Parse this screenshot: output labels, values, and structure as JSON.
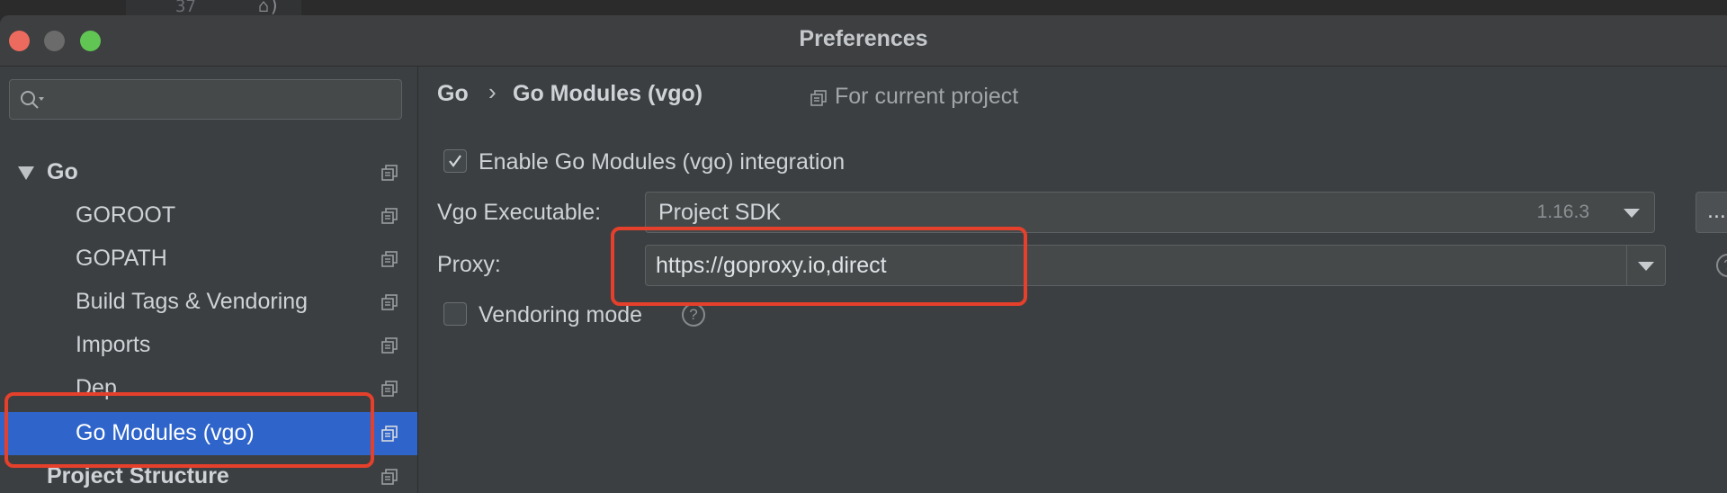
{
  "editor": {
    "line_number": "37",
    "glyph": "⌂)"
  },
  "window": {
    "title": "Preferences"
  },
  "sidebar": {
    "search": {
      "value": "",
      "placeholder": ""
    },
    "items": [
      {
        "label": "Go"
      },
      {
        "label": "GOROOT"
      },
      {
        "label": "GOPATH"
      },
      {
        "label": "Build Tags & Vendoring"
      },
      {
        "label": "Imports"
      },
      {
        "label": "Dep"
      },
      {
        "label": "Go Modules (vgo)"
      },
      {
        "label": "Project Structure"
      }
    ],
    "selected": "Go Modules (vgo)"
  },
  "main": {
    "breadcrumb": {
      "parent": "Go",
      "separator": "›",
      "current": "Go Modules (vgo)"
    },
    "scope": "For current project",
    "enable_modules": {
      "label": "Enable Go Modules (vgo) integration",
      "checked": true
    },
    "vgo_executable": {
      "label": "Vgo Executable:",
      "value": "Project SDK",
      "version": "1.16.3",
      "browse_label": "..."
    },
    "proxy": {
      "label": "Proxy:",
      "value": "https://goproxy.io,direct"
    },
    "vendoring": {
      "label": "Vendoring mode",
      "checked": false,
      "help": "?"
    }
  },
  "colors": {
    "selection": "#2f65ca",
    "annotation": "#e5402b",
    "close": "#ed6a5e",
    "maximize": "#61c554"
  }
}
